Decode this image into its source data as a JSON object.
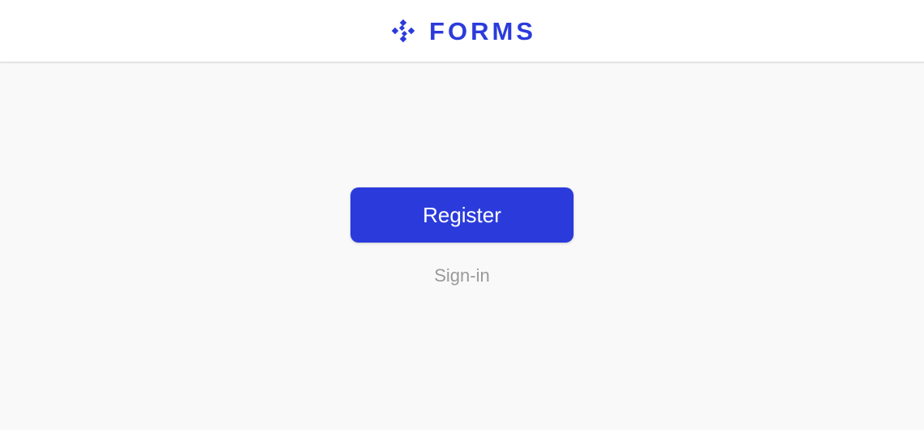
{
  "header": {
    "logo_icon": "diamond-grid-icon",
    "brand_name": "FORMS",
    "brand_color": "#2b3bdb"
  },
  "main": {
    "register_label": "Register",
    "signin_label": "Sign-in",
    "background": "#f9f9f9"
  }
}
